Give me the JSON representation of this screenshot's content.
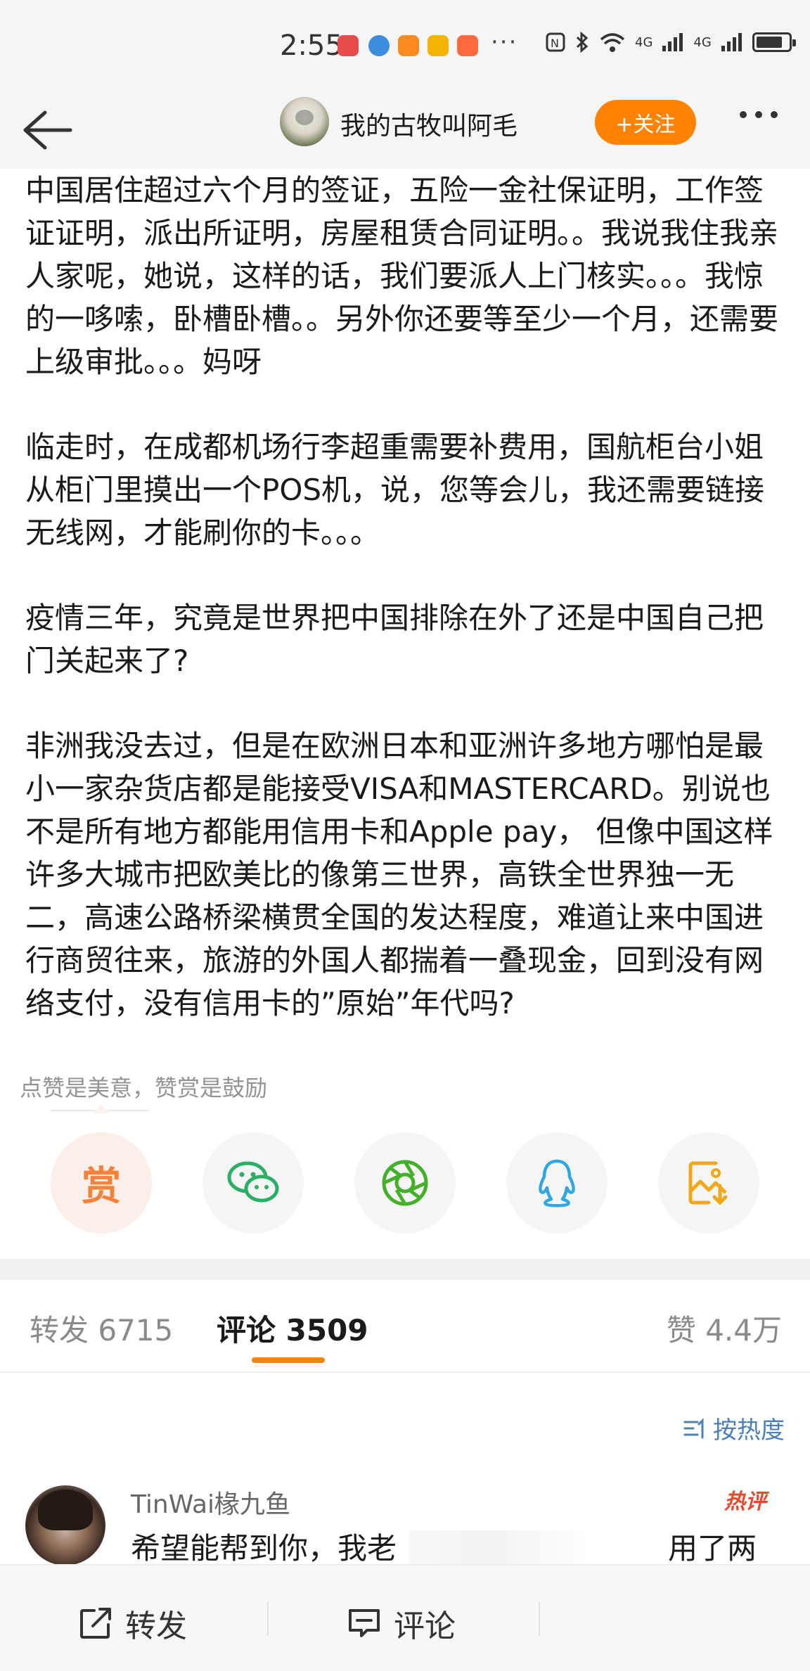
{
  "status_bar": {
    "time": "2:55",
    "dots": "···",
    "network": "4G",
    "app_colors": [
      "#e94a4a",
      "#3b8de0",
      "#ff8a1e",
      "#f6b200",
      "#ff6a3d"
    ]
  },
  "nav": {
    "title": "我的古牧叫阿毛",
    "follow_label": "+关注"
  },
  "article": {
    "paragraphs": [
      "中国居住超过六个月的签证，五险一金社保证明，工作签证证明，派出所证明，房屋租赁合同证明。。我说我住我亲人家呢，她说，这样的话，我们要派人上门核实。。。我惊的一哆嗦，卧槽卧槽。。另外你还要等至少一个月，还需要上级审批。。。妈呀",
      "临走时，在成都机场行李超重需要补费用，国航柜台小姐从柜门里摸出一个POS机，说，您等会儿，我还需要链接无线网，才能刷你的卡。。。",
      "疫情三年，究竟是世界把中国排除在外了还是中国自己把门关起来了?",
      "非洲我没去过，但是在欧洲日本和亚洲许多地方哪怕是最小一家杂货店都是能接受VISA和MASTERCARD。别说也不是所有地方都能用信用卡和Apple pay， 但像中国这样许多大城市把欧美比的像第三世界，高铁全世界独一无二，高速公路桥梁横贯全国的发达程度，难道让来中国进行商贸往来，旅游的外国人都揣着一叠现金，回到没有网络支付，没有信用卡的”原始”年代吗?"
    ]
  },
  "reward": {
    "hint": "点赞是美意，赞赏是鼓励",
    "reward_label": "赏"
  },
  "share_icons": [
    "reward-icon",
    "wechat-icon",
    "moments-icon",
    "qq-icon",
    "save-image-icon"
  ],
  "tabs": {
    "repost": "转发 6715",
    "comment": "评论 3509",
    "like": "赞 4.4万"
  },
  "sort_label": "按热度",
  "comment": {
    "user": "TinWai椽九鱼",
    "badge": "热评",
    "text_start": "希望能帮到你，我老",
    "text_end": "用了两"
  },
  "bottom_bar": {
    "repost": "转发",
    "comment": "评论"
  },
  "colors": {
    "accent": "#ff8200",
    "link": "#4a7fb8",
    "hot": "#e8482e"
  }
}
